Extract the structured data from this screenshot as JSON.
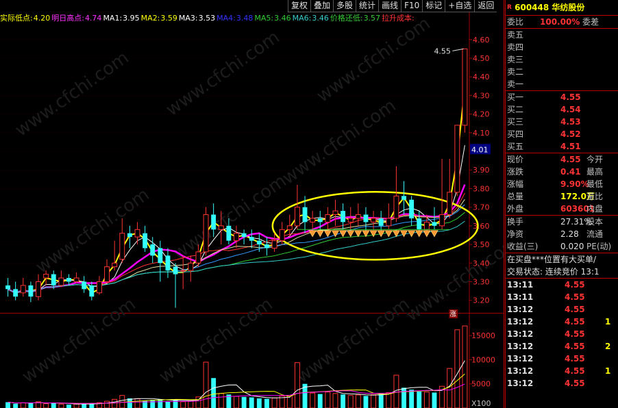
{
  "toolbar": {
    "buttons": [
      "复权",
      "叠加",
      "多股",
      "统计",
      "画线",
      "F10",
      "标记",
      "+自选",
      "返回"
    ]
  },
  "indicators": [
    {
      "label": "实际低点:",
      "value": "4.20",
      "color": "#ffff00"
    },
    {
      "label": "明日高点:",
      "value": "4.74",
      "color": "#ff33ff"
    },
    {
      "label": "MA1:",
      "value": "3.95",
      "color": "#ffffff"
    },
    {
      "label": "MA2:",
      "value": "3.59",
      "color": "#ffff00"
    },
    {
      "label": "MA3:",
      "value": "3.53",
      "color": "#ffffff"
    },
    {
      "label": "MA4:",
      "value": "3.48",
      "color": "#3333ff"
    },
    {
      "label": "MA5:",
      "value": "3.46",
      "color": "#33cc33"
    },
    {
      "label": "MA6:",
      "value": "3.46",
      "color": "#33cccc"
    },
    {
      "label": "价格还低:",
      "value": "3.57",
      "color": "#33cc33"
    },
    {
      "label": "拉升成本:",
      "value": "",
      "color": "#ff3333"
    }
  ],
  "stock": {
    "badge": "R",
    "code": "600448",
    "name": "华纺股份"
  },
  "order_summary": [
    {
      "label": "委比",
      "value": "100.00%",
      "label2": "委差"
    }
  ],
  "ask_rows": [
    {
      "label": "卖五",
      "price": ""
    },
    {
      "label": "卖四",
      "price": ""
    },
    {
      "label": "卖三",
      "price": ""
    },
    {
      "label": "卖二",
      "price": ""
    },
    {
      "label": "卖一",
      "price": ""
    }
  ],
  "bid_rows": [
    {
      "label": "买一",
      "price": "4.55"
    },
    {
      "label": "买二",
      "price": "4.54"
    },
    {
      "label": "买三",
      "price": "4.53"
    },
    {
      "label": "买四",
      "price": "4.52"
    },
    {
      "label": "买五",
      "price": "4.51"
    }
  ],
  "stats": [
    {
      "label": "现价",
      "value": "4.55",
      "value_color": "#ff3333",
      "label2": "今开"
    },
    {
      "label": "涨跌",
      "value": "0.41",
      "value_color": "#ff3333",
      "label2": "最高"
    },
    {
      "label": "涨幅",
      "value": "9.90%",
      "value_color": "#ff3333",
      "label2": "最低"
    },
    {
      "label": "总量",
      "value": "172.0万",
      "value_color": "#ffff00",
      "label2": "量比"
    },
    {
      "label": "外盘",
      "value": "603601",
      "value_color": "#ff3333",
      "label2": "内盘"
    }
  ],
  "stats2": [
    {
      "label": "换手",
      "value": "27.31%",
      "label2": "股本"
    },
    {
      "label": "净资",
      "value": "2.28",
      "label2": "流通"
    },
    {
      "label": "收益(三)",
      "value": "0.020",
      "label2": "PE(动)"
    }
  ],
  "notices": [
    "在买盘***位置有大买单/",
    "交易状态: 连续竞价 13:1"
  ],
  "ticks": [
    {
      "time": "13:11",
      "price": "4.55",
      "vol": ""
    },
    {
      "time": "13:11",
      "price": "4.55",
      "vol": ""
    },
    {
      "time": "13:12",
      "price": "4.55",
      "vol": ""
    },
    {
      "time": "13:12",
      "price": "4.55",
      "vol": "1"
    },
    {
      "time": "13:12",
      "price": "4.55",
      "vol": ""
    },
    {
      "time": "13:12",
      "price": "4.55",
      "vol": "2"
    },
    {
      "time": "13:12",
      "price": "4.55",
      "vol": ""
    },
    {
      "time": "13:12",
      "price": "4.55",
      "vol": "1"
    },
    {
      "time": "13:12",
      "price": "4.55",
      "vol": ""
    }
  ],
  "current_price_tag": "4.01",
  "limit_up_badge": "涨",
  "volume_unit": "X100",
  "chart_data": {
    "type": "candlestick",
    "price_axis": {
      "ylim": [
        3.14,
        4.68
      ],
      "ticks": [
        3.2,
        3.3,
        3.4,
        3.5,
        3.6,
        3.7,
        3.8,
        3.9,
        4.0,
        4.1,
        4.2,
        4.3,
        4.4,
        4.5,
        4.6
      ]
    },
    "volume_axis": {
      "ylim": [
        0,
        19000
      ],
      "ticks": [
        5000,
        10000,
        15000
      ]
    },
    "peak_annotation": "4.55",
    "candles": [
      {
        "o": 3.28,
        "c": 3.26,
        "h": 3.32,
        "l": 3.22,
        "v": 1200
      },
      {
        "o": 3.26,
        "c": 3.22,
        "h": 3.3,
        "l": 3.2,
        "v": 900
      },
      {
        "o": 3.24,
        "c": 3.28,
        "h": 3.32,
        "l": 3.22,
        "v": 1100
      },
      {
        "o": 3.28,
        "c": 3.22,
        "h": 3.3,
        "l": 3.19,
        "v": 1000
      },
      {
        "o": 3.22,
        "c": 3.3,
        "h": 3.34,
        "l": 3.2,
        "v": 1300
      },
      {
        "o": 3.32,
        "c": 3.34,
        "h": 3.36,
        "l": 3.28,
        "v": 900
      },
      {
        "o": 3.34,
        "c": 3.28,
        "h": 3.36,
        "l": 3.26,
        "v": 1000
      },
      {
        "o": 3.28,
        "c": 3.32,
        "h": 3.36,
        "l": 3.27,
        "v": 800
      },
      {
        "o": 3.32,
        "c": 3.3,
        "h": 3.34,
        "l": 3.28,
        "v": 700
      },
      {
        "o": 3.3,
        "c": 3.32,
        "h": 3.35,
        "l": 3.29,
        "v": 800
      },
      {
        "o": 3.3,
        "c": 3.26,
        "h": 3.33,
        "l": 3.24,
        "v": 900
      },
      {
        "o": 3.28,
        "c": 3.22,
        "h": 3.3,
        "l": 3.2,
        "v": 1000
      },
      {
        "o": 3.24,
        "c": 3.3,
        "h": 3.33,
        "l": 3.23,
        "v": 1100
      },
      {
        "o": 3.3,
        "c": 3.38,
        "h": 3.42,
        "l": 3.29,
        "v": 1400
      },
      {
        "o": 3.38,
        "c": 3.4,
        "h": 3.52,
        "l": 3.36,
        "v": 1800
      },
      {
        "o": 3.42,
        "c": 3.56,
        "h": 3.64,
        "l": 3.4,
        "v": 2600
      },
      {
        "o": 3.56,
        "c": 3.54,
        "h": 3.6,
        "l": 3.48,
        "v": 2000
      },
      {
        "o": 3.54,
        "c": 3.58,
        "h": 3.62,
        "l": 3.5,
        "v": 1900
      },
      {
        "o": 3.56,
        "c": 3.48,
        "h": 3.6,
        "l": 3.46,
        "v": 1500
      },
      {
        "o": 3.5,
        "c": 3.44,
        "h": 3.54,
        "l": 3.4,
        "v": 1700
      },
      {
        "o": 3.48,
        "c": 3.4,
        "h": 3.52,
        "l": 3.3,
        "v": 1800
      },
      {
        "o": 3.44,
        "c": 3.36,
        "h": 3.48,
        "l": 3.32,
        "v": 1400
      },
      {
        "o": 3.38,
        "c": 3.34,
        "h": 3.4,
        "l": 3.16,
        "v": 1700
      },
      {
        "o": 3.36,
        "c": 3.36,
        "h": 3.44,
        "l": 3.26,
        "v": 1300
      },
      {
        "o": 3.36,
        "c": 3.4,
        "h": 3.44,
        "l": 3.3,
        "v": 1500
      },
      {
        "o": 3.4,
        "c": 3.46,
        "h": 3.5,
        "l": 3.38,
        "v": 2300
      },
      {
        "o": 3.46,
        "c": 3.66,
        "h": 3.7,
        "l": 3.44,
        "v": 9500
      },
      {
        "o": 3.66,
        "c": 3.58,
        "h": 3.72,
        "l": 3.54,
        "v": 6200
      },
      {
        "o": 3.58,
        "c": 3.6,
        "h": 3.68,
        "l": 3.5,
        "v": 3000
      },
      {
        "o": 3.6,
        "c": 3.52,
        "h": 3.64,
        "l": 3.5,
        "v": 2800
      },
      {
        "o": 3.52,
        "c": 3.56,
        "h": 3.6,
        "l": 3.48,
        "v": 2400
      },
      {
        "o": 3.56,
        "c": 3.54,
        "h": 3.58,
        "l": 3.5,
        "v": 2300
      },
      {
        "o": 3.54,
        "c": 3.52,
        "h": 3.58,
        "l": 3.48,
        "v": 2200
      },
      {
        "o": 3.52,
        "c": 3.5,
        "h": 3.56,
        "l": 3.46,
        "v": 2000
      },
      {
        "o": 3.5,
        "c": 3.48,
        "h": 3.54,
        "l": 3.44,
        "v": 1900
      },
      {
        "o": 3.48,
        "c": 3.52,
        "h": 3.56,
        "l": 3.46,
        "v": 2100
      },
      {
        "o": 3.52,
        "c": 3.58,
        "h": 3.62,
        "l": 3.5,
        "v": 2500
      },
      {
        "o": 3.58,
        "c": 3.6,
        "h": 3.66,
        "l": 3.54,
        "v": 2600
      },
      {
        "o": 3.6,
        "c": 3.7,
        "h": 3.82,
        "l": 3.58,
        "v": 9400
      },
      {
        "o": 3.7,
        "c": 3.62,
        "h": 3.76,
        "l": 3.56,
        "v": 5000
      },
      {
        "o": 3.62,
        "c": 3.64,
        "h": 3.68,
        "l": 3.58,
        "v": 3100
      },
      {
        "o": 3.64,
        "c": 3.62,
        "h": 3.68,
        "l": 3.58,
        "v": 2900
      },
      {
        "o": 3.62,
        "c": 3.66,
        "h": 3.7,
        "l": 3.58,
        "v": 3300
      },
      {
        "o": 3.66,
        "c": 3.68,
        "h": 3.74,
        "l": 3.6,
        "v": 3000
      },
      {
        "o": 3.68,
        "c": 3.62,
        "h": 3.72,
        "l": 3.58,
        "v": 2800
      },
      {
        "o": 3.62,
        "c": 3.64,
        "h": 3.7,
        "l": 3.58,
        "v": 2600
      },
      {
        "o": 3.64,
        "c": 3.66,
        "h": 3.72,
        "l": 3.6,
        "v": 2700
      },
      {
        "o": 3.66,
        "c": 3.62,
        "h": 3.7,
        "l": 3.56,
        "v": 2500
      },
      {
        "o": 3.62,
        "c": 3.64,
        "h": 3.68,
        "l": 3.58,
        "v": 2800
      },
      {
        "o": 3.64,
        "c": 3.6,
        "h": 3.68,
        "l": 3.56,
        "v": 3000
      },
      {
        "o": 3.6,
        "c": 3.64,
        "h": 3.72,
        "l": 3.58,
        "v": 3200
      },
      {
        "o": 3.64,
        "c": 3.76,
        "h": 3.92,
        "l": 3.62,
        "v": 6800
      },
      {
        "o": 3.76,
        "c": 3.74,
        "h": 3.84,
        "l": 3.66,
        "v": 4200
      },
      {
        "o": 3.74,
        "c": 3.64,
        "h": 3.76,
        "l": 3.6,
        "v": 3800
      },
      {
        "o": 3.64,
        "c": 3.58,
        "h": 3.68,
        "l": 3.56,
        "v": 3400
      },
      {
        "o": 3.58,
        "c": 3.62,
        "h": 3.66,
        "l": 3.56,
        "v": 3300
      },
      {
        "o": 3.62,
        "c": 3.6,
        "h": 3.7,
        "l": 3.58,
        "v": 3200
      },
      {
        "o": 3.6,
        "c": 3.66,
        "h": 3.96,
        "l": 3.58,
        "v": 4500
      },
      {
        "o": 3.66,
        "c": 3.78,
        "h": 3.96,
        "l": 3.64,
        "v": 8200
      },
      {
        "o": 3.78,
        "c": 4.14,
        "h": 4.14,
        "l": 3.76,
        "v": 16200
      },
      {
        "o": 4.14,
        "c": 4.55,
        "h": 4.55,
        "l": 4.1,
        "v": 17000
      }
    ]
  }
}
